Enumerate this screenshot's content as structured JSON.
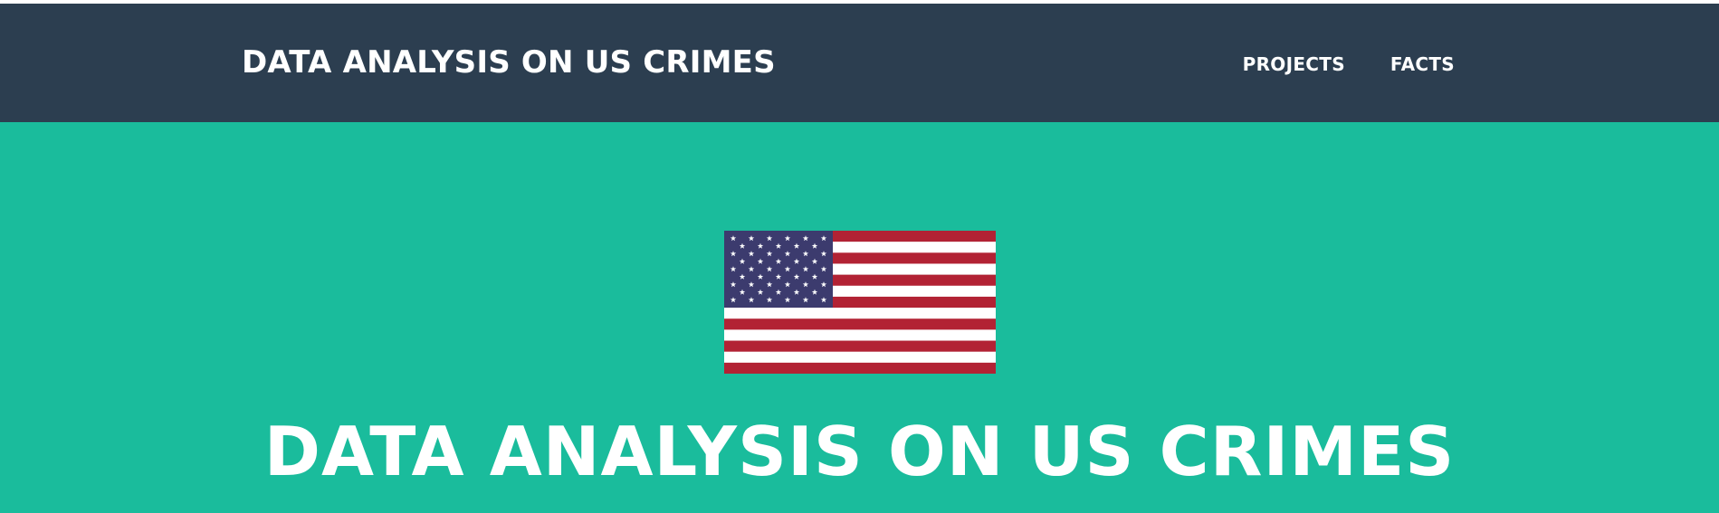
{
  "navbar": {
    "brand": "DATA ANALYSIS ON US CRIMES",
    "links": [
      "PROJECTS",
      "FACTS"
    ]
  },
  "hero": {
    "image": "us-flag",
    "title": "DATA ANALYSIS ON US CRIMES"
  },
  "colors": {
    "navbar": "#2c3e50",
    "hero": "#1abc9c",
    "text": "#ffffff",
    "flag_red": "#b22234",
    "flag_blue": "#3c3b6e"
  }
}
